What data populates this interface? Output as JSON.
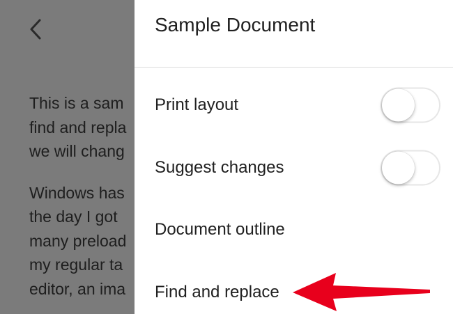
{
  "background_document": {
    "paragraphs": [
      [
        "This is a sam",
        "find and repla",
        "we will chang"
      ],
      [
        "Windows has",
        "the day I got",
        "many preload",
        "my regular ta",
        "editor, an ima"
      ]
    ]
  },
  "drawer": {
    "title": "Sample Document",
    "items": [
      {
        "label": "Print layout",
        "has_toggle": true,
        "toggle_on": false
      },
      {
        "label": "Suggest changes",
        "has_toggle": true,
        "toggle_on": false
      },
      {
        "label": "Document outline",
        "has_toggle": false
      },
      {
        "label": "Find and replace",
        "has_toggle": false
      }
    ]
  },
  "colors": {
    "overlay_gray": "#7b7b7b",
    "annotation_arrow": "#e8001c",
    "text": "#202020"
  },
  "icons": {
    "back": "chevron-left-icon",
    "annotation": "red-arrow-icon"
  }
}
